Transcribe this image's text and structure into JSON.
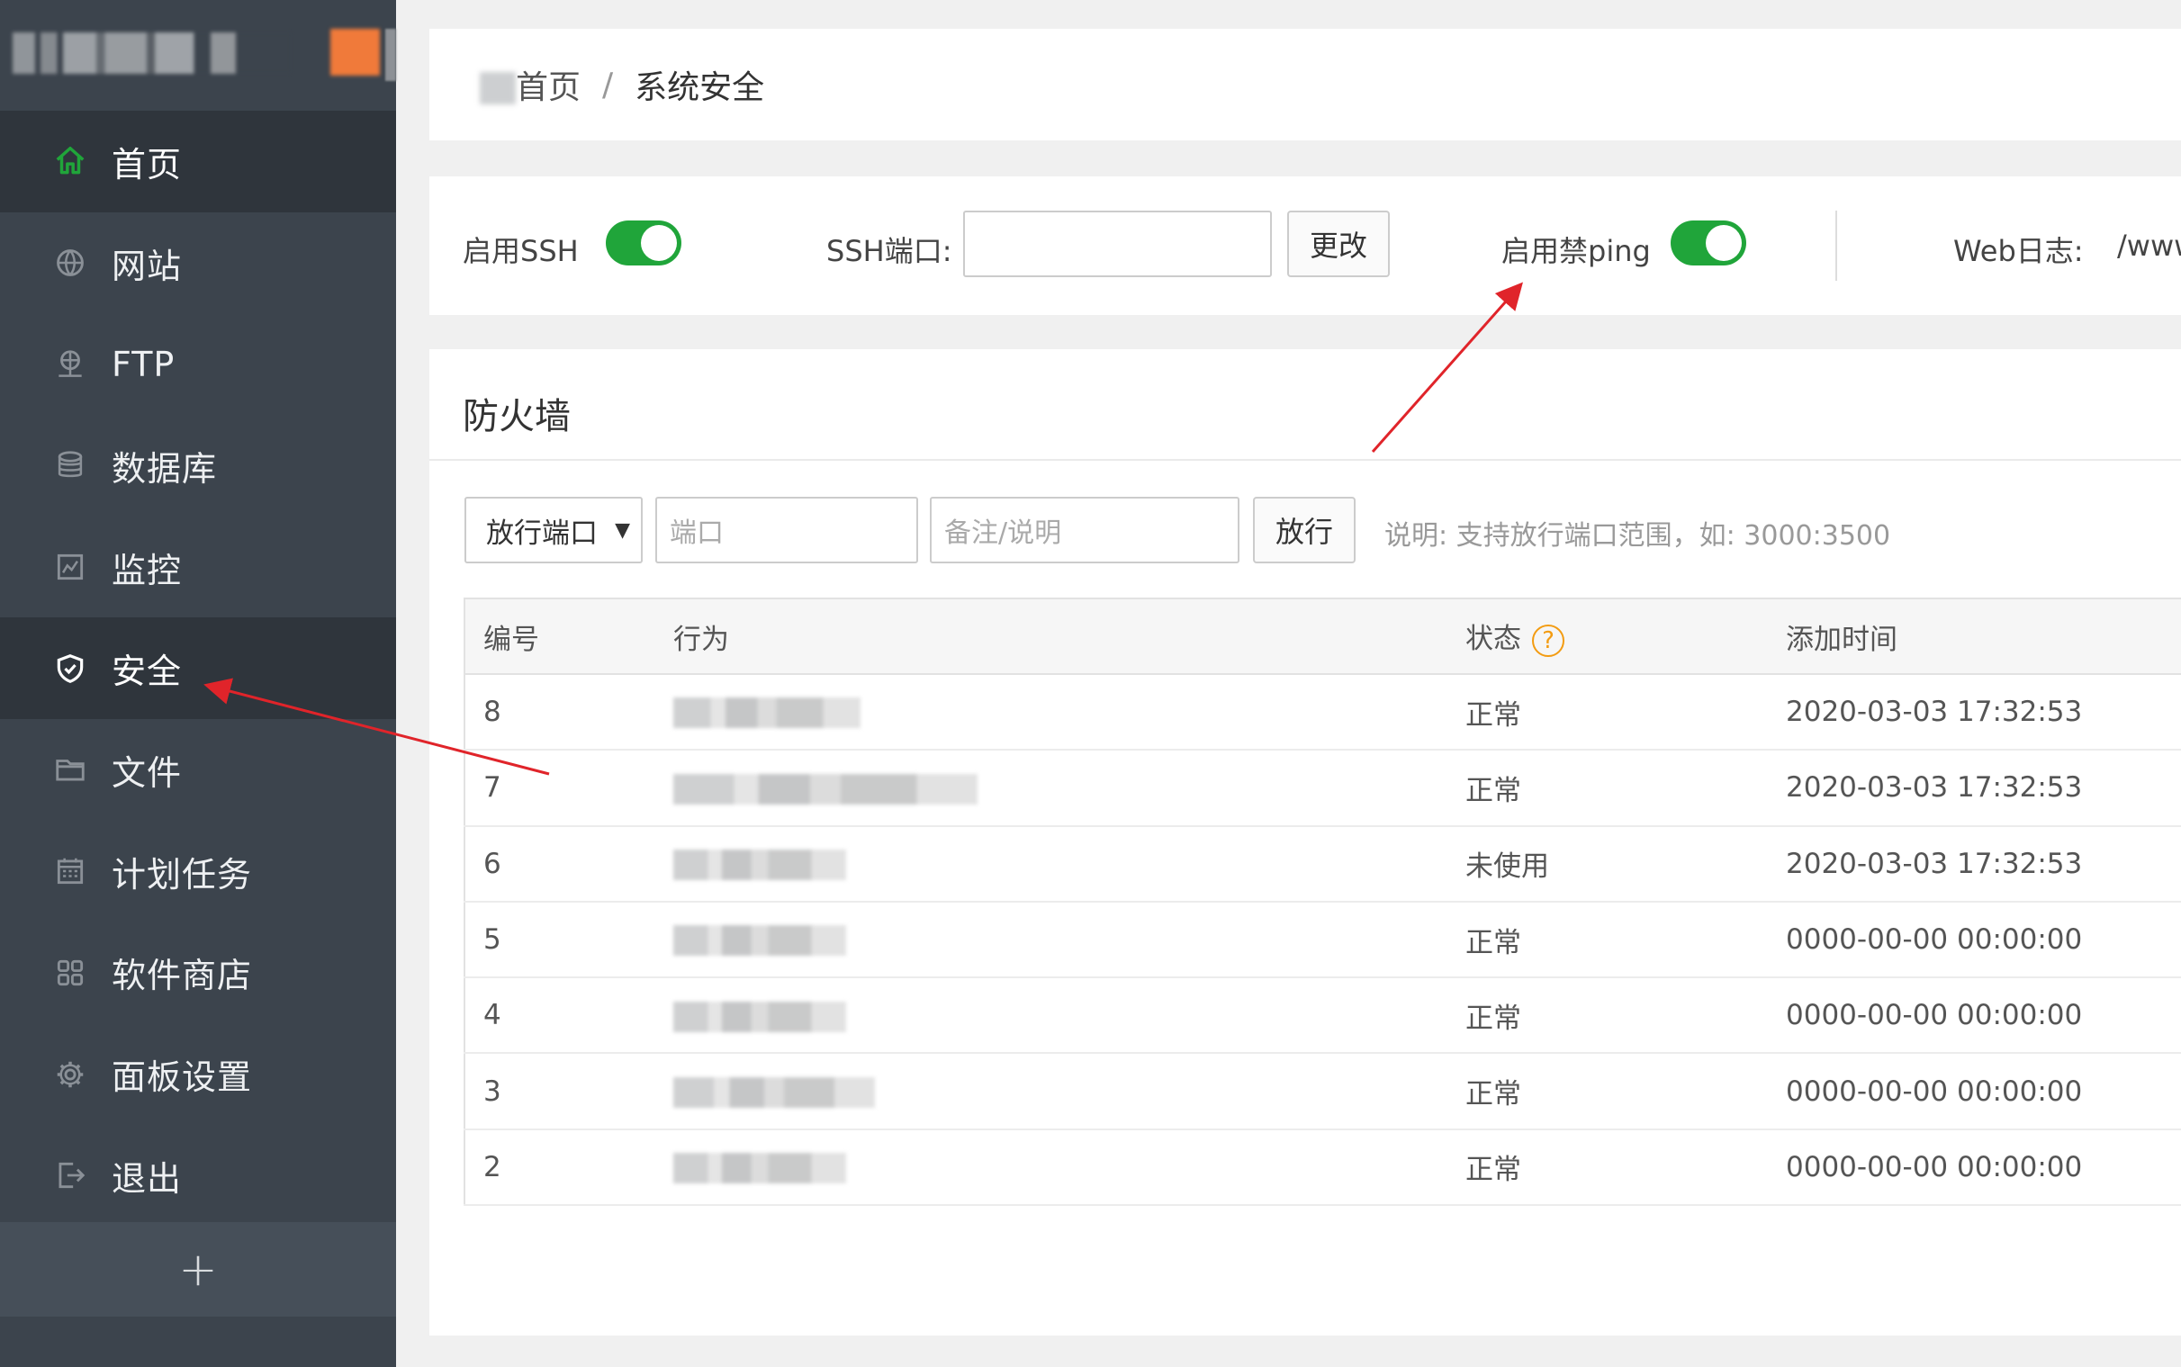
{
  "sidebar": {
    "items": [
      {
        "label": "首页",
        "icon": "home-icon",
        "active": true
      },
      {
        "label": "网站",
        "icon": "globe-icon"
      },
      {
        "label": "FTP",
        "icon": "ftp-icon"
      },
      {
        "label": "数据库",
        "icon": "database-icon"
      },
      {
        "label": "监控",
        "icon": "monitor-icon"
      },
      {
        "label": "安全",
        "icon": "shield-icon",
        "active": true
      },
      {
        "label": "文件",
        "icon": "folder-icon"
      },
      {
        "label": "计划任务",
        "icon": "calendar-icon"
      },
      {
        "label": "软件商店",
        "icon": "grid-icon"
      },
      {
        "label": "面板设置",
        "icon": "gear-icon"
      },
      {
        "label": "退出",
        "icon": "logout-icon"
      }
    ],
    "add_label": "+"
  },
  "breadcrumb": {
    "home": "首页",
    "separator": "/",
    "current": "系统安全"
  },
  "settings": {
    "ssh_label": "启用SSH",
    "ssh_enabled": true,
    "ssh_port_label": "SSH端口:",
    "ssh_port_value": "",
    "change_button": "更改",
    "noping_label": "启用禁ping",
    "noping_enabled": true,
    "weblog_label": "Web日志:",
    "weblog_path": "/www/"
  },
  "firewall": {
    "title": "防火墙",
    "select_value": "放行端口",
    "port_placeholder": "端口",
    "note_placeholder": "备注/说明",
    "allow_button": "放行",
    "hint": "说明: 支持放行端口范围，如: 3000:3500",
    "columns": [
      "编号",
      "行为",
      "状态",
      "添加时间"
    ],
    "rows": [
      {
        "id": "8",
        "status": "正常",
        "time": "2020-03-03 17:32:53"
      },
      {
        "id": "7",
        "status": "正常",
        "time": "2020-03-03 17:32:53"
      },
      {
        "id": "6",
        "status": "未使用",
        "time": "2020-03-03 17:32:53"
      },
      {
        "id": "5",
        "status": "正常",
        "time": "0000-00-00 00:00:00"
      },
      {
        "id": "4",
        "status": "正常",
        "time": "0000-00-00 00:00:00"
      },
      {
        "id": "3",
        "status": "正常",
        "time": "0000-00-00 00:00:00"
      },
      {
        "id": "2",
        "status": "正常",
        "time": "0000-00-00 00:00:00"
      }
    ]
  },
  "colors": {
    "accent_green": "#20a53a",
    "sidebar_bg": "#3c444d",
    "sidebar_active": "#2f353c",
    "annotation_red": "#e0242a",
    "help_orange": "#f39c12"
  }
}
